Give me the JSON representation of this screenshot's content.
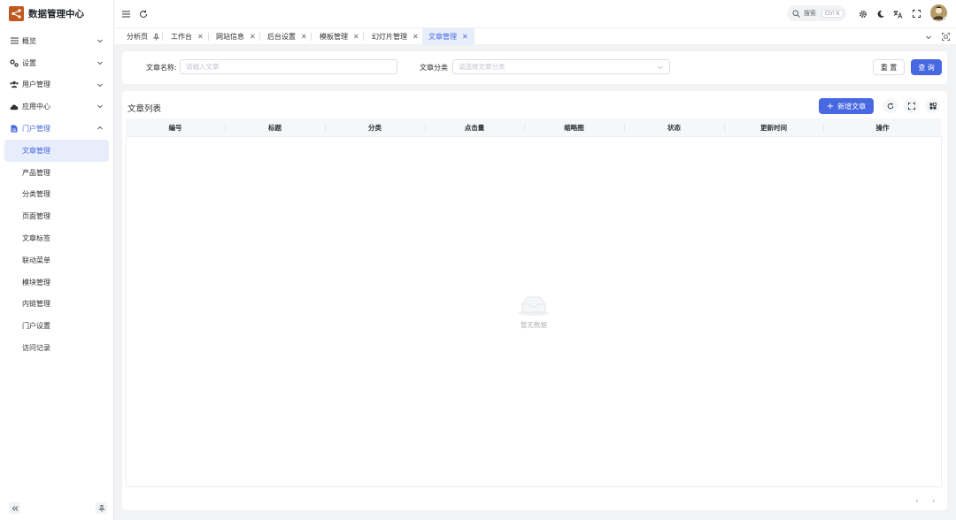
{
  "app": {
    "title": "数据管理中心"
  },
  "sidebar": {
    "items": [
      {
        "label": "概览",
        "icon": "list-icon"
      },
      {
        "label": "设置",
        "icon": "settings-icon"
      },
      {
        "label": "用户管理",
        "icon": "users-icon"
      },
      {
        "label": "应用中心",
        "icon": "cloud-icon"
      },
      {
        "label": "门户管理",
        "icon": "document-icon"
      }
    ],
    "subitems": [
      "文章管理",
      "产品管理",
      "分类管理",
      "页面管理",
      "文章标签",
      "联动菜单",
      "模块管理",
      "内链管理",
      "门户设置",
      "访问记录"
    ],
    "active_subitem": "文章管理"
  },
  "header": {
    "search_placeholder": "搜索",
    "search_shortcut": "Ctrl K"
  },
  "tabs": [
    {
      "label": "分析页",
      "pinned": true
    },
    {
      "label": "工作台"
    },
    {
      "label": "网站信息"
    },
    {
      "label": "后台设置"
    },
    {
      "label": "模板管理"
    },
    {
      "label": "幻灯片管理"
    },
    {
      "label": "文章管理",
      "active": true
    }
  ],
  "filters": {
    "title_label": "文章名称:",
    "title_placeholder": "请输入文章",
    "category_label": "文章分类",
    "category_placeholder": "请选择文章分类",
    "reset_label": "重 置",
    "search_label": "查 询"
  },
  "table": {
    "title": "文章列表",
    "add_label": "新增文章",
    "columns": [
      "编号",
      "标题",
      "分类",
      "点击量",
      "缩略图",
      "状态",
      "更新时间",
      "操作"
    ],
    "rows": [],
    "empty_text": "暂无数据"
  },
  "colors": {
    "accent": "#4768e0",
    "logo": "#c05a1e"
  }
}
